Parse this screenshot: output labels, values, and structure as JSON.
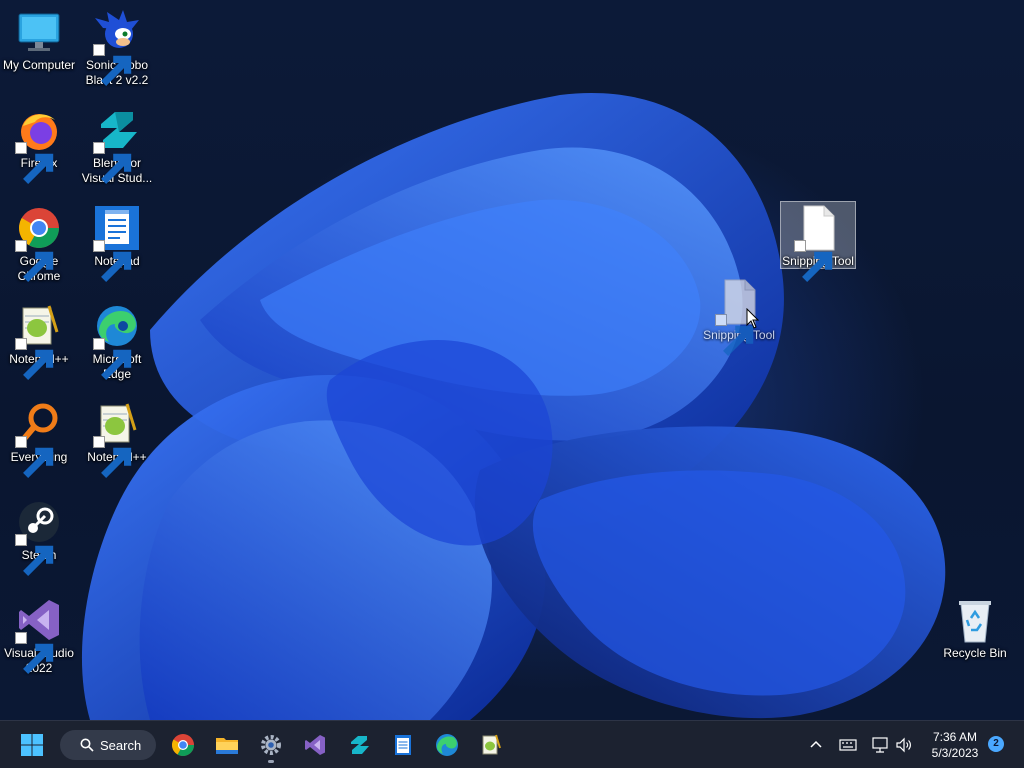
{
  "desktop": {
    "icons": {
      "my_computer": "My Computer",
      "sonic": "Sonic Robo Blast 2 v2.2",
      "firefox": "Firefox",
      "blend": "Blend for Visual Stud...",
      "chrome": "Google Chrome",
      "notepad": "Notepad",
      "notepadpp_1": "Notepad++",
      "edge": "Microsoft Edge",
      "everything": "Everything",
      "notepadpp_2": "Notepad++",
      "steam": "Steam",
      "visual_studio": "Visual Studio 2022",
      "snipping_selected": "Snipping Tool",
      "snipping_drag": "Snipping Tool",
      "recycle_bin": "Recycle Bin"
    }
  },
  "taskbar": {
    "search_label": "Search",
    "apps": [
      "start-icon",
      "chrome-icon",
      "file-explorer-icon",
      "settings-icon",
      "visual-studio-icon",
      "blend-icon",
      "notepad-icon",
      "edge-icon",
      "notepadpp-icon"
    ],
    "clock_time": "7:36 AM",
    "clock_date": "5/3/2023",
    "notification_count": "2"
  },
  "colors": {
    "taskbar_bg": "#1c2230",
    "accent": "#4aa8ff",
    "wallpaper_blue": "#1e4fe0"
  }
}
